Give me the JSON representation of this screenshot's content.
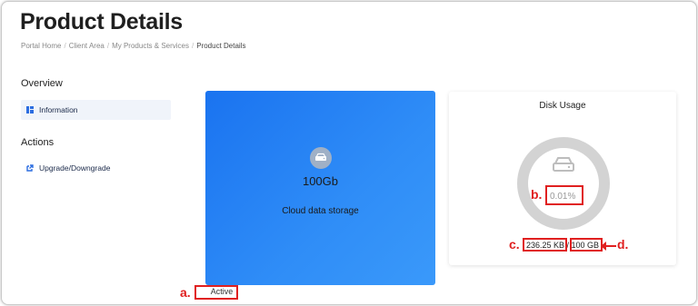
{
  "header": {
    "title": "Product Details",
    "breadcrumb": [
      "Portal Home",
      "Client Area",
      "My Products & Services",
      "Product Details"
    ]
  },
  "sidebar": {
    "overview_heading": "Overview",
    "overview_items": [
      {
        "label": "Information",
        "icon": "list-icon",
        "active": true
      }
    ],
    "actions_heading": "Actions",
    "actions_items": [
      {
        "label": "Upgrade/Downgrade",
        "icon": "external-link-icon"
      }
    ]
  },
  "product": {
    "size": "100Gb",
    "description": "Cloud data storage",
    "status": "Active"
  },
  "disk": {
    "title": "Disk Usage",
    "percent": "0.01%",
    "used": "236.25 KB",
    "separator": "/",
    "total": "100 GB"
  },
  "annotations": {
    "a": "a.",
    "b": "b.",
    "c": "c.",
    "d": "d."
  },
  "colors": {
    "card_gradient_start": "#1a73f0",
    "card_gradient_end": "#3a99fa",
    "annotation_red": "#e02020",
    "ring_gray": "#d3d3d3"
  }
}
